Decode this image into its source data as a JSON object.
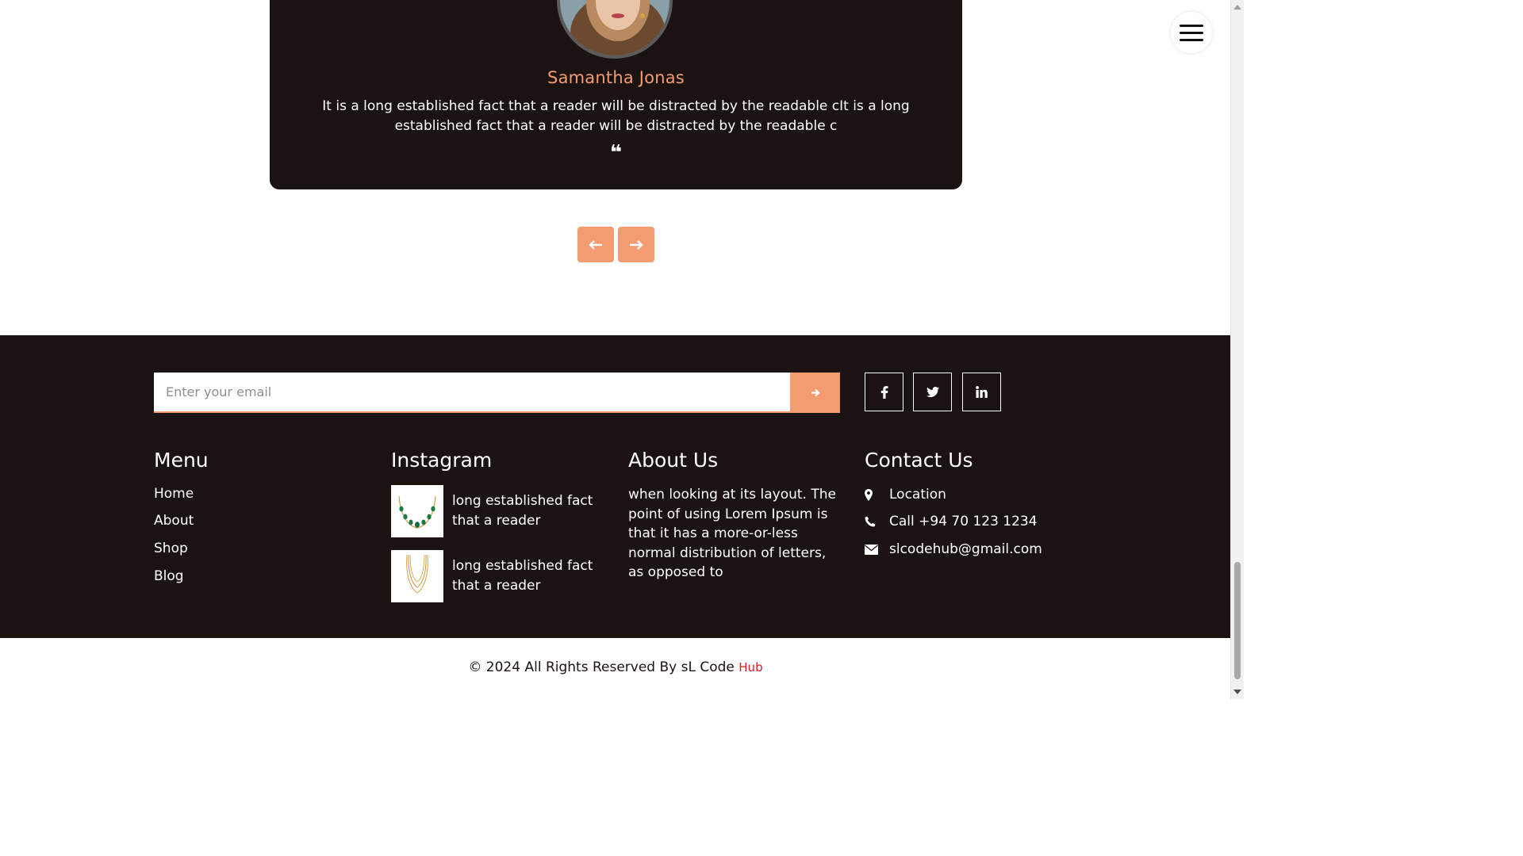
{
  "testimonial": {
    "name": "Samantha Jonas",
    "text": "It is a long established fact that a reader will be distracted by the readable cIt is a long established fact that a reader will be distracted by the readable c",
    "quote_glyph": "❝"
  },
  "footer": {
    "email_placeholder": "Enter your email",
    "social": [
      "facebook",
      "twitter",
      "linkedin"
    ],
    "menu": {
      "title": "Menu",
      "items": [
        "Home",
        "About",
        "Shop",
        "Blog"
      ]
    },
    "instagram": {
      "title": "Instagram",
      "posts": [
        {
          "caption": "long established fact that a reader",
          "image": "emerald-necklace-image"
        },
        {
          "caption": "long established fact that a reader",
          "image": "gold-chain-necklace-image"
        }
      ]
    },
    "about": {
      "title": "About Us",
      "text": "when looking at its layout. The point of using Lorem Ipsum is that it has a more-or-less normal distribution of letters, as opposed to"
    },
    "contact": {
      "title": "Contact Us",
      "location": "Location",
      "phone": "Call +94 70 123 1234",
      "email": "slcodehub@gmail.com"
    }
  },
  "copyright": {
    "text": "© 2024 All Rights Reserved By sL Code",
    "brand": "Hub"
  },
  "colors": {
    "accent": "#f39c72",
    "dark": "#1a1311",
    "brand_red": "#e01b1b"
  }
}
